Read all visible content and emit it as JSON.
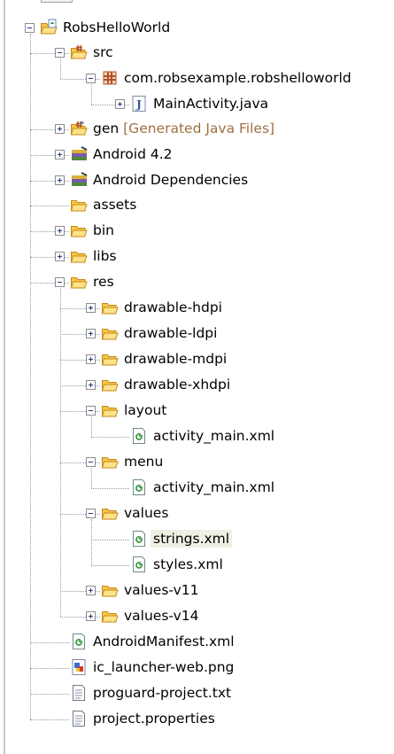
{
  "tree": {
    "rows": [
      {
        "label": "RobsHelloWorld",
        "icon": "android-project-icon",
        "expanded": true
      },
      {
        "label": "src",
        "icon": "source-folder-icon",
        "expanded": true
      },
      {
        "label": "com.robsexample.robshelloworld",
        "icon": "package-icon",
        "expanded": true
      },
      {
        "label": "MainActivity.java",
        "icon": "java-file-icon",
        "expanded": false
      },
      {
        "label": "gen",
        "decoration": "[Generated Java Files]",
        "icon": "generated-source-folder-icon",
        "expanded": false
      },
      {
        "label": "Android 4.2",
        "icon": "library-icon",
        "expanded": false
      },
      {
        "label": "Android Dependencies",
        "icon": "library-icon",
        "expanded": false
      },
      {
        "label": "assets",
        "icon": "folder-icon"
      },
      {
        "label": "bin",
        "icon": "folder-icon",
        "expanded": false
      },
      {
        "label": "libs",
        "icon": "folder-icon",
        "expanded": false
      },
      {
        "label": "res",
        "icon": "folder-icon",
        "expanded": true
      },
      {
        "label": "drawable-hdpi",
        "icon": "folder-icon",
        "expanded": false
      },
      {
        "label": "drawable-ldpi",
        "icon": "folder-icon",
        "expanded": false
      },
      {
        "label": "drawable-mdpi",
        "icon": "folder-icon",
        "expanded": false
      },
      {
        "label": "drawable-xhdpi",
        "icon": "folder-icon",
        "expanded": false
      },
      {
        "label": "layout",
        "icon": "folder-icon",
        "expanded": true
      },
      {
        "label": "activity_main.xml",
        "icon": "xml-file-icon"
      },
      {
        "label": "menu",
        "icon": "folder-icon",
        "expanded": true
      },
      {
        "label": "activity_main.xml",
        "icon": "xml-file-icon"
      },
      {
        "label": "values",
        "icon": "folder-icon",
        "expanded": true
      },
      {
        "label": "strings.xml",
        "icon": "xml-file-icon",
        "selected": true
      },
      {
        "label": "styles.xml",
        "icon": "xml-file-icon"
      },
      {
        "label": "values-v11",
        "icon": "folder-icon",
        "expanded": false
      },
      {
        "label": "values-v14",
        "icon": "folder-icon",
        "expanded": false
      },
      {
        "label": "AndroidManifest.xml",
        "icon": "xml-file-icon"
      },
      {
        "label": "ic_launcher-web.png",
        "icon": "image-file-icon"
      },
      {
        "label": "proguard-project.txt",
        "icon": "text-file-icon"
      },
      {
        "label": "project.properties",
        "icon": "text-file-icon"
      }
    ]
  },
  "colors": {
    "folder": "#f7c54a",
    "folder_outline": "#c48a17",
    "package": "#b0532a",
    "java_letter": "#3155a6",
    "xml_green": "#3e9b4a",
    "selection": "#f0efe3",
    "decoration": "#a07040"
  }
}
